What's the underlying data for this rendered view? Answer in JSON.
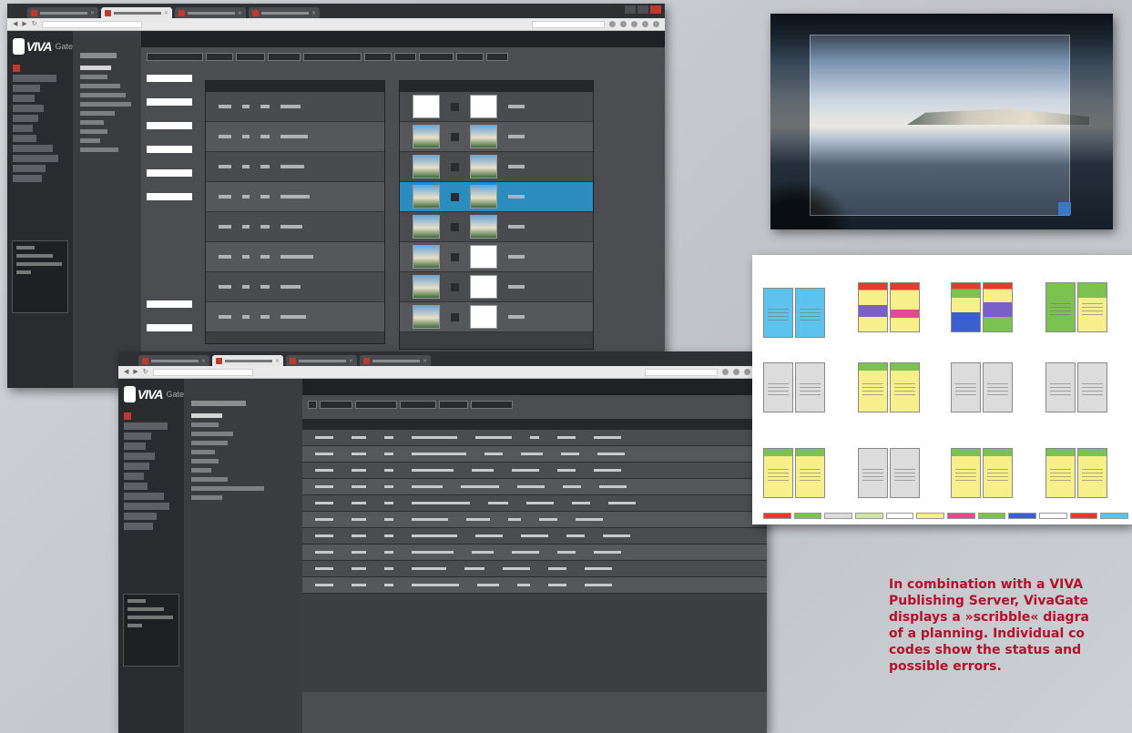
{
  "app": {
    "logo_text": "VIVA",
    "logo_suffix": "Gate"
  },
  "caption": {
    "text": "In combination with a VIVA\nPublishing Server, VivaGate\ndisplays a »scribble« diagra\nof a planning. Individual co\ncodes show the status and\npossible errors."
  },
  "colors": {
    "accent_red": "#c0392b",
    "selection_blue": "#2b8cbf",
    "caption_red": "#b5122a",
    "sky_blue": "#5cc4ec",
    "scribble_yellow": "#f6ef8a",
    "scribble_green": "#7cc250",
    "scribble_grey": "#dcdcdc"
  },
  "icons": {
    "back": "back-arrow-icon",
    "forward": "forward-arrow-icon",
    "reload": "reload-icon",
    "close": "close-icon"
  }
}
